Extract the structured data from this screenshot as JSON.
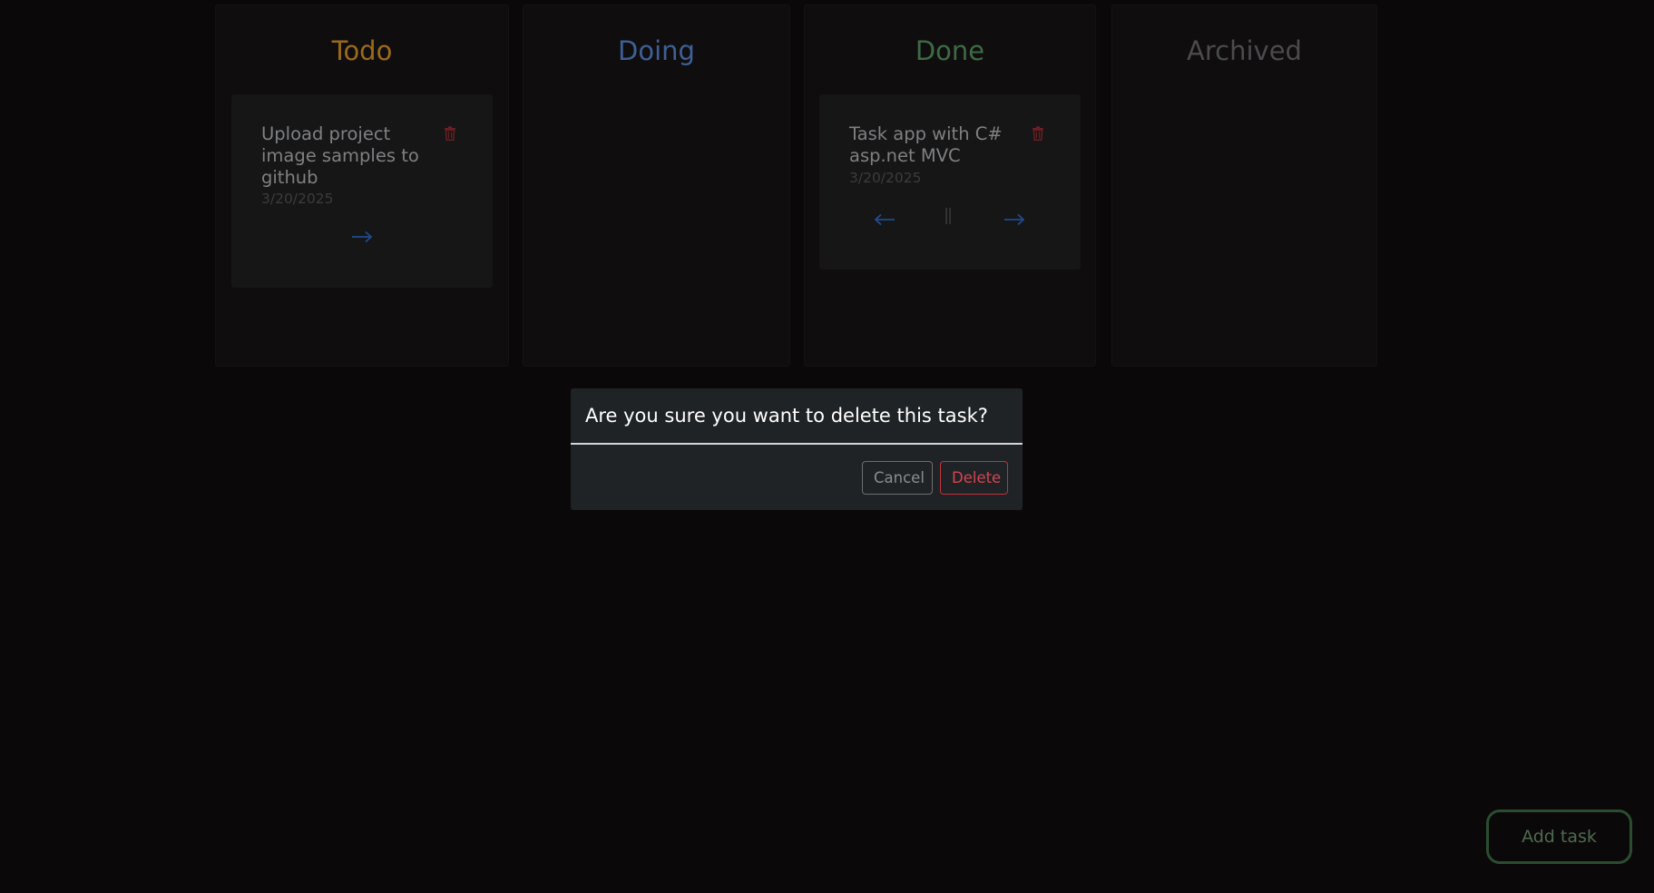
{
  "board": {
    "columns": [
      {
        "title": "Todo",
        "color": "#9a6a19"
      },
      {
        "title": "Doing",
        "color": "#3f5f95"
      },
      {
        "title": "Done",
        "color": "#3f6a45"
      },
      {
        "title": "Archived",
        "color": "#4a4b4c"
      }
    ],
    "todo_cards": [
      {
        "title": "Upload project image samples to github",
        "date": "3/20/2025",
        "icons": [
          "trash-icon",
          "arrow-right-icon"
        ]
      }
    ],
    "done_cards": [
      {
        "title": "Task app with C# asp.net MVC",
        "date": "3/20/2025",
        "icons": [
          "trash-icon",
          "arrow-left-icon",
          "pause-icon",
          "arrow-right-icon"
        ]
      }
    ]
  },
  "modal": {
    "title": "Are you sure you want to delete this task?",
    "cancel_label": "Cancel",
    "delete_label": "Delete"
  },
  "add_task_label": "Add task",
  "colors": {
    "background": "#0b0809",
    "danger": "#d44550",
    "arrow": "#1f4b8f",
    "success_outline": "#2a4d30"
  }
}
